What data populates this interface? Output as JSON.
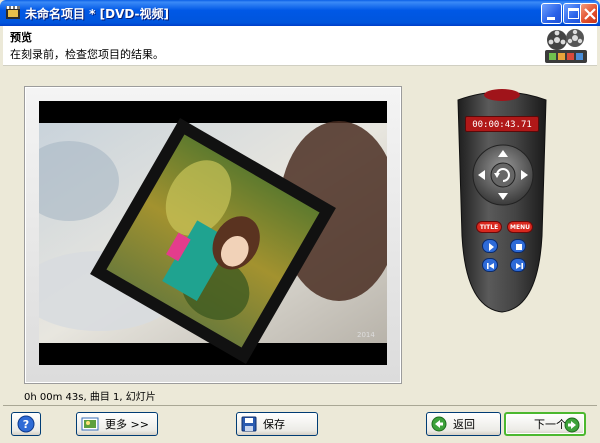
{
  "window": {
    "title": "未命名项目 * [DVD-视频]"
  },
  "header": {
    "title": "预览",
    "subtitle": "在刻录前，检查您项目的结果。"
  },
  "preview": {
    "status": "0h 00m 43s, 曲目 1, 幻灯片"
  },
  "remote": {
    "time_display": "00:00:43.71",
    "title_label": "TITLE",
    "menu_label": "MENU"
  },
  "buttons": {
    "help": "?",
    "more": "更多 >>",
    "save": "保存",
    "back": "返回",
    "next": "下一个"
  },
  "colors": {
    "titlebar": "#0055DC",
    "remote_body": "#3A3A3A",
    "remote_button_red": "#D9281E",
    "remote_button_blue": "#2E6BD8",
    "next_border": "#4CB82F"
  }
}
